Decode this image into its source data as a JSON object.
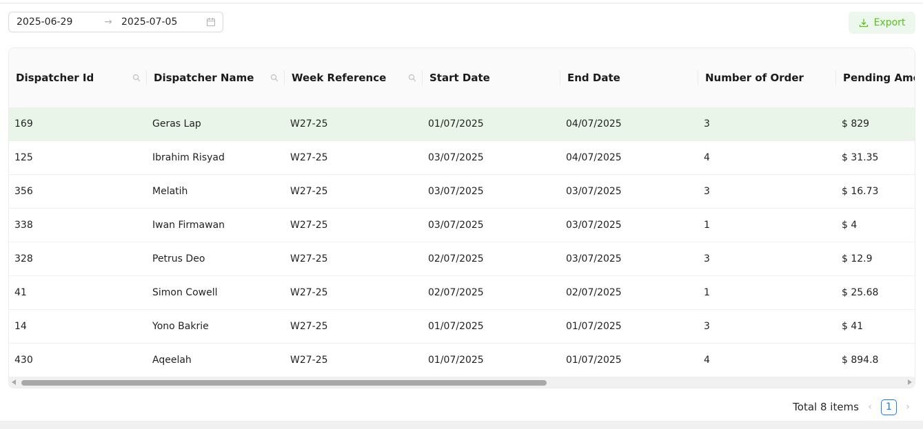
{
  "date_range": {
    "start": "2025-06-29",
    "separator": "→",
    "end": "2025-07-05",
    "icon": "calendar-icon"
  },
  "export_button": {
    "label": "Export",
    "icon": "download-icon",
    "color": "#52c41a"
  },
  "table": {
    "columns": [
      {
        "key": "dispatcher_id",
        "label": "Dispatcher Id",
        "searchable": true
      },
      {
        "key": "dispatcher_name",
        "label": "Dispatcher Name",
        "searchable": true
      },
      {
        "key": "week_reference",
        "label": "Week Reference",
        "searchable": true
      },
      {
        "key": "start_date",
        "label": "Start Date",
        "searchable": false
      },
      {
        "key": "end_date",
        "label": "End Date",
        "searchable": false
      },
      {
        "key": "number_of_order",
        "label": "Number of Order",
        "searchable": false
      },
      {
        "key": "pending_amount",
        "label": "Pending Amou",
        "searchable": false
      }
    ],
    "rows": [
      [
        "169",
        "Geras Lap",
        "W27-25",
        "01/07/2025",
        "04/07/2025",
        "3",
        "$ 829"
      ],
      [
        "125",
        "Ibrahim Risyad",
        "W27-25",
        "03/07/2025",
        "04/07/2025",
        "4",
        "$ 31.35"
      ],
      [
        "356",
        "Melatih",
        "W27-25",
        "03/07/2025",
        "03/07/2025",
        "3",
        "$ 16.73"
      ],
      [
        "338",
        "Iwan Firmawan",
        "W27-25",
        "03/07/2025",
        "03/07/2025",
        "1",
        "$ 4"
      ],
      [
        "328",
        "Petrus Deo",
        "W27-25",
        "02/07/2025",
        "03/07/2025",
        "3",
        "$ 12.9"
      ],
      [
        "41",
        "Simon Cowell",
        "W27-25",
        "02/07/2025",
        "02/07/2025",
        "1",
        "$ 25.68"
      ],
      [
        "14",
        "Yono Bakrie",
        "W27-25",
        "01/07/2025",
        "01/07/2025",
        "3",
        "$ 41"
      ],
      [
        "430",
        "Aqeelah",
        "W27-25",
        "01/07/2025",
        "01/07/2025",
        "4",
        "$ 894.8"
      ]
    ],
    "highlight_color": "#eaf5ea"
  },
  "pagination": {
    "total_label": "Total 8 items",
    "current_page": "1",
    "prev": "‹",
    "next": "›",
    "accent": "#1677ff"
  }
}
